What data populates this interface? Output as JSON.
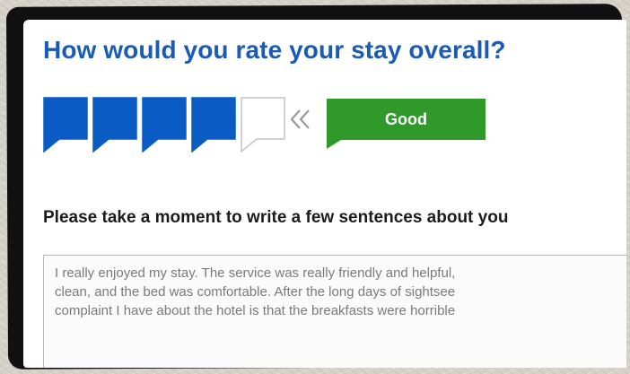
{
  "question": {
    "title": "How would you rate your stay overall?"
  },
  "rating": {
    "value": 4,
    "max": 5,
    "label": "Good",
    "filled_color": "#0a5cc4",
    "empty_color": "#ffffff",
    "label_color": "#2f9a2a",
    "arrow_icon": "double-chevron-left-icon",
    "bubble_icon": "speech-bubble-icon"
  },
  "review": {
    "prompt": "Please take a moment to write a few sentences about you",
    "text": "I really enjoyed my stay. The service was really friendly and helpful,\nclean, and the bed was comfortable. After the long days of sightsee\ncomplaint I have about the hotel is that the breakfasts were horrible"
  }
}
